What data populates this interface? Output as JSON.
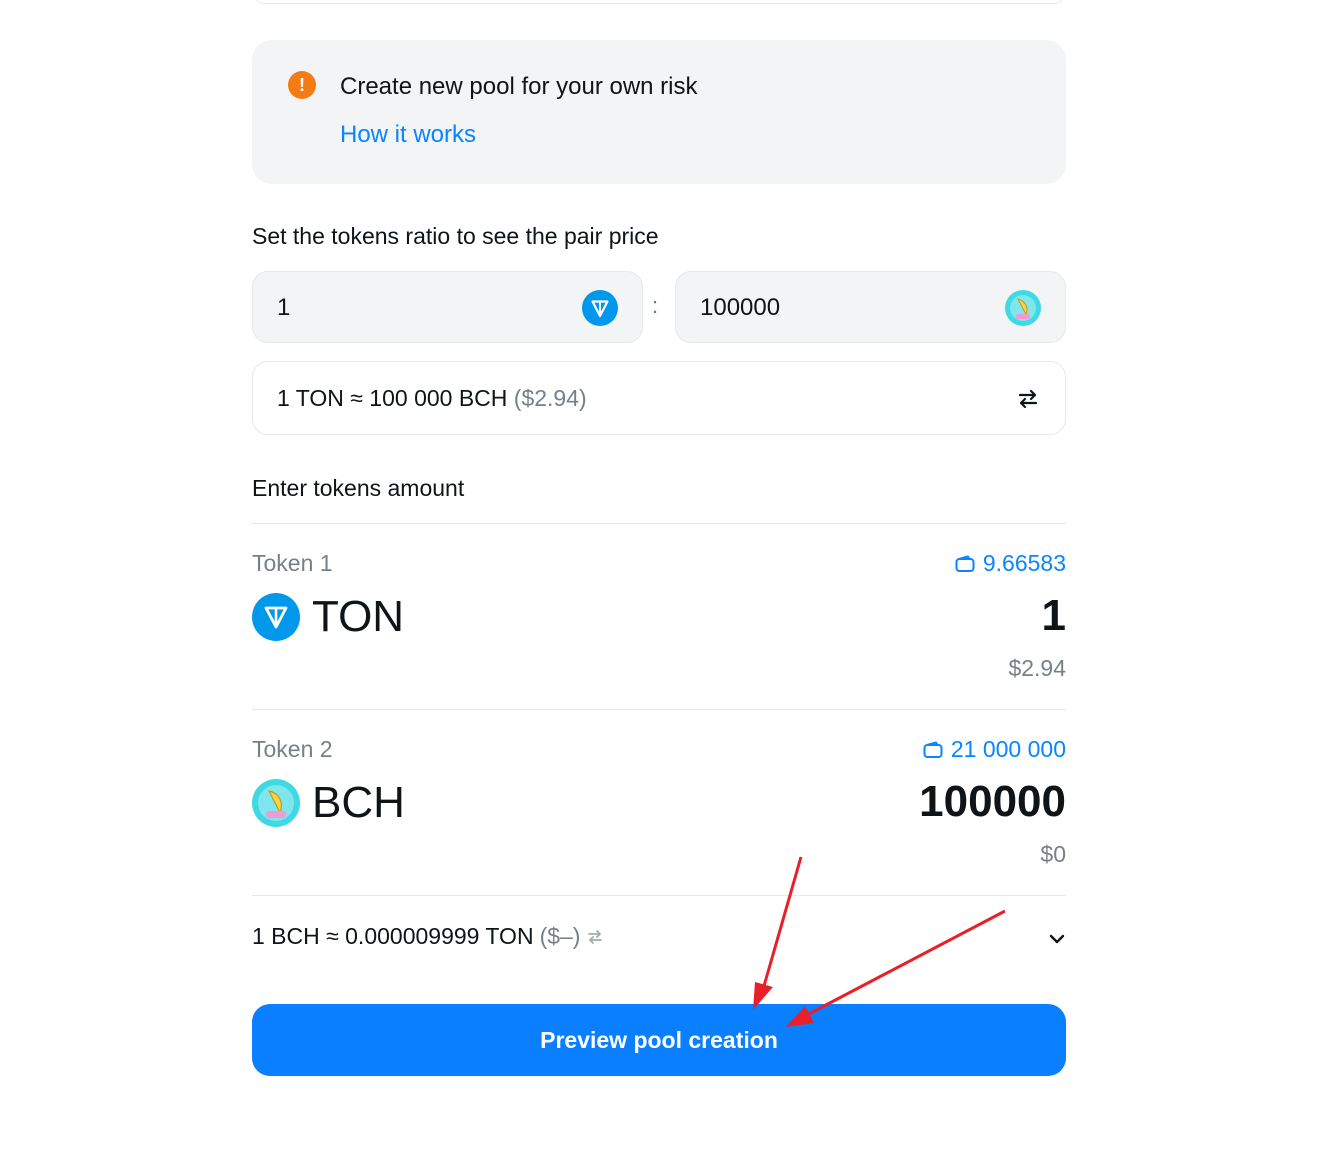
{
  "warning": {
    "text": "Create new pool for your own risk",
    "link": "How it works",
    "icon": "exclamation-icon",
    "color": "#f57c14"
  },
  "ratio": {
    "title": "Set the tokens ratio to see the pair price",
    "left_value": "1",
    "left_icon": "ton-logo-icon",
    "separator": ":",
    "right_value": "100000",
    "right_icon": "banana-tool-logo-icon"
  },
  "price": {
    "main": "1 TON ≈ 100 000 BCH",
    "usd": "($2.94)",
    "swap_icon": "swap-arrows-icon"
  },
  "amounts": {
    "title": "Enter tokens amount",
    "token1": {
      "label": "Token 1",
      "balance": "9.66583",
      "symbol": "TON",
      "amount": "1",
      "usd": "$2.94"
    },
    "token2": {
      "label": "Token 2",
      "balance": "21 000 000",
      "symbol": "BCH",
      "amount": "100000",
      "usd": "$0"
    }
  },
  "rate": {
    "main": "1 BCH ≈ 0.000009999 TON",
    "usd": "($–)"
  },
  "action": {
    "label": "Preview pool creation"
  },
  "colors": {
    "accent": "#0a7fff",
    "link": "#0a84ff",
    "annotation_arrow": "#e8202a"
  }
}
